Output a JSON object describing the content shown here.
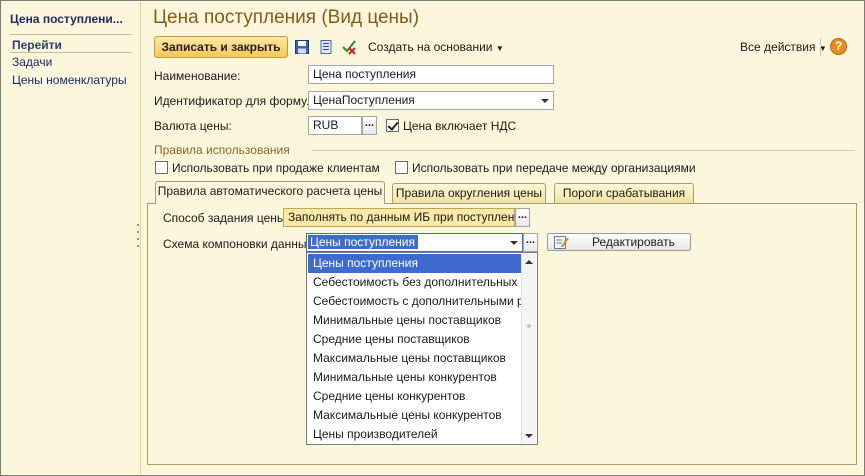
{
  "sidebar": {
    "title": "Цена поступлени...",
    "goto_label": "Перейти",
    "links": [
      "Задачи",
      "Цены номенклатуры"
    ]
  },
  "header": {
    "title": "Цена поступления (Вид цены)"
  },
  "toolbar": {
    "save_close_label": "Записать и закрыть",
    "create_on_basis_label": "Создать на основании",
    "all_actions_label": "Все действия",
    "help_label": "?",
    "icons": [
      "save-icon",
      "list-icon",
      "mark-delete-icon",
      "help-icon"
    ]
  },
  "form": {
    "name_label": "Наименование:",
    "name_value": "Цена поступления",
    "id_label": "Идентификатор для формул:",
    "id_value": "ЦенаПоступления",
    "currency_label": "Валюта цены:",
    "currency_value": "RUB",
    "vat_label": "Цена включает НДС",
    "vat_checked": true
  },
  "usage": {
    "title": "Правила использования",
    "sell_label": "Использовать при продаже клиентам",
    "sell_checked": false,
    "transfer_label": "Использовать при передаче между организациями",
    "transfer_checked": false
  },
  "tabs": [
    {
      "label": "Правила автоматического расчета цены",
      "active": true
    },
    {
      "label": "Правила округления цены",
      "active": false
    },
    {
      "label": "Пороги срабатывания",
      "active": false
    }
  ],
  "auto_calc": {
    "method_label": "Способ задания цены:",
    "method_value": "Заполнять по данным ИБ при поступлении",
    "scheme_label": "Схема компоновки данных:",
    "scheme_value": "Цены поступления",
    "edit_label": "Редактировать",
    "dropdown_items": [
      "Цены поступления",
      "Себестоимость без дополнительных р...",
      "Себестоимость с дополнительными р...",
      "Минимальные цены поставщиков",
      "Средние цены поставщиков",
      "Максимальные цены поставщиков",
      "Минимальные цены конкурентов",
      "Средние цены конкурентов",
      "Максимальные цены конкурентов",
      "Цены производителей"
    ],
    "selected_index": 0
  },
  "colors": {
    "background": "#fbf6dc",
    "title": "#8a5a14",
    "primary_button": "#f6c75a",
    "selection": "#3f6bd1",
    "help": "#e98e1e"
  }
}
